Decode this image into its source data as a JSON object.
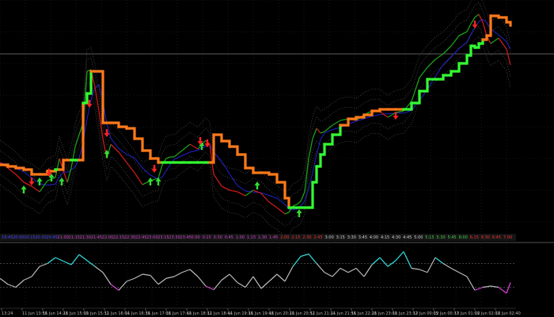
{
  "window": {
    "background": "#000000"
  },
  "chart_data": [
    {
      "type": "line",
      "panel": "price",
      "grid": true,
      "colors": {
        "trail_up": "#33ff33",
        "trail_down": "#ff7a1a",
        "price_up": "#1aa01a",
        "price_down": "#cc1a1a",
        "signal": "#2222cc",
        "band": "#666666",
        "arrow_up": "#33dd33",
        "arrow_down": "#ff2222"
      },
      "x": [
        0,
        10,
        20,
        30,
        40,
        50,
        60,
        70,
        75,
        80,
        85,
        90,
        95,
        100,
        105,
        110,
        115,
        120,
        125,
        130,
        135,
        140,
        150,
        160,
        170,
        180,
        190,
        200,
        205,
        210,
        215,
        220,
        230,
        240,
        250,
        260,
        265,
        270,
        280,
        290,
        300,
        310,
        320,
        330,
        340,
        350,
        360,
        365,
        370,
        375,
        380,
        385,
        390,
        395,
        400,
        405,
        410,
        420,
        430,
        440,
        450,
        460,
        470,
        480,
        490,
        500,
        510,
        520,
        530,
        540,
        550,
        560,
        570,
        580,
        590,
        595,
        600,
        605,
        610,
        615,
        620,
        630,
        640,
        645
      ],
      "series": [
        {
          "role": "price",
          "values": [
            205,
            212,
            220,
            230,
            235,
            242,
            228,
            224,
            200,
            215,
            230,
            212,
            185,
            170,
            155,
            90,
            88,
            110,
            140,
            175,
            200,
            182,
            192,
            205,
            218,
            233,
            228,
            225,
            208,
            200,
            198,
            198,
            190,
            182,
            188,
            177,
            182,
            220,
            235,
            240,
            242,
            247,
            240,
            244,
            255,
            262,
            270,
            268,
            260,
            258,
            254,
            242,
            200,
            175,
            162,
            168,
            166,
            158,
            152,
            150,
            152,
            145,
            140,
            141,
            148,
            142,
            140,
            128,
            98,
            85,
            75,
            68,
            58,
            45,
            40,
            30,
            22,
            18,
            28,
            45,
            55,
            48,
            62,
            82
          ]
        },
        {
          "role": "trailing_stop",
          "values": [
            208,
            210,
            212,
            214,
            220,
            220,
            216,
            214,
            214,
            202,
            202,
            202,
            202,
            202,
            130,
            118,
            90,
            90,
            90,
            155,
            155,
            155,
            160,
            162,
            175,
            190,
            200,
            205,
            205,
            205,
            205,
            205,
            205,
            205,
            205,
            205,
            205,
            170,
            178,
            185,
            195,
            212,
            218,
            218,
            220,
            230,
            250,
            262,
            262,
            262,
            262,
            262,
            262,
            230,
            210,
            195,
            182,
            170,
            158,
            150,
            148,
            145,
            140,
            138,
            138,
            138,
            138,
            130,
            115,
            100,
            100,
            95,
            90,
            80,
            70,
            58,
            60,
            55,
            50,
            45,
            20,
            22,
            28,
            32
          ]
        }
      ],
      "signals_up": [
        [
          30,
          240
        ],
        [
          50,
          230
        ],
        [
          65,
          225
        ],
        [
          78,
          230
        ],
        [
          135,
          195
        ],
        [
          190,
          230
        ],
        [
          200,
          230
        ],
        [
          255,
          185
        ],
        [
          325,
          235
        ],
        [
          378,
          270
        ]
      ],
      "signals_down": [
        [
          40,
          228
        ],
        [
          62,
          217
        ],
        [
          113,
          130
        ],
        [
          135,
          167
        ],
        [
          195,
          212
        ],
        [
          253,
          177
        ],
        [
          262,
          180
        ],
        [
          500,
          145
        ],
        [
          600,
          30
        ]
      ],
      "x_tick_labels": [
        "19:45",
        "20:00",
        "20:15",
        "20:30",
        "20:45",
        "21:00",
        "21:15",
        "21:30",
        "21:45",
        "22:00",
        "22:15",
        "22:30",
        "22:45",
        "23:00",
        "23:15",
        "23:30",
        "23:45",
        "0:00",
        "0:15",
        "0:30",
        "0:45",
        "1:00",
        "1:15",
        "1:30",
        "1:45",
        "2:00",
        "2:15",
        "2:30",
        "2:45",
        "3:00",
        "3:15",
        "3:30",
        "3:45",
        "4:00",
        "4:15",
        "4:30",
        "4:45",
        "5:00",
        "5:15",
        "5:30",
        "5:45",
        "6:00",
        "6:15",
        "6:30",
        "6:45",
        "7:00"
      ]
    },
    {
      "type": "line",
      "panel": "oscillator",
      "grid": true,
      "colors": {
        "high": "#33e0e0",
        "mid": "#bbbbbb",
        "low": "#e040e0",
        "level": "#555555"
      },
      "levels": [
        70,
        30
      ],
      "ylim": [
        0,
        100
      ],
      "x": [
        0,
        10,
        20,
        30,
        40,
        50,
        60,
        70,
        80,
        90,
        100,
        110,
        120,
        130,
        140,
        150,
        160,
        170,
        180,
        190,
        200,
        210,
        220,
        230,
        240,
        250,
        260,
        270,
        280,
        290,
        300,
        310,
        320,
        330,
        340,
        350,
        360,
        370,
        380,
        390,
        400,
        410,
        420,
        430,
        440,
        450,
        460,
        470,
        480,
        490,
        500,
        510,
        520,
        530,
        540,
        550,
        560,
        570,
        580,
        590,
        600,
        610,
        620,
        630,
        640,
        645
      ],
      "values": [
        45,
        35,
        30,
        42,
        48,
        65,
        70,
        80,
        74,
        68,
        85,
        75,
        65,
        55,
        35,
        25,
        40,
        45,
        52,
        50,
        35,
        45,
        48,
        55,
        60,
        48,
        32,
        26,
        42,
        52,
        38,
        30,
        48,
        28,
        40,
        52,
        40,
        65,
        82,
        86,
        70,
        55,
        48,
        62,
        55,
        62,
        48,
        68,
        80,
        65,
        75,
        90,
        62,
        60,
        55,
        80,
        70,
        62,
        55,
        48,
        25,
        30,
        32,
        30,
        20,
        38
      ]
    }
  ],
  "bottom_tick_labels": [
    "13:24",
    "11 Jun 13:56",
    "11 Jun 14:28",
    "11 Jun 15:00",
    "11 Jun 15:32",
    "11 Jun 16:04",
    "11 Jun 16:36",
    "11 Jun 17:08",
    "11 Jun 17:40",
    "11 Jun 18:12",
    "11 Jun 18:44",
    "11 Jun 19:16",
    "11 Jun 19:48",
    "11 Jun 20:20",
    "11 Jun 20:52",
    "11 Jun 21:24",
    "11 Jun 21:56",
    "11 Jun 22:28",
    "11 Jun 23:00",
    "11 Jun 23:32",
    "12 Jun 00:05",
    "12 Jun 00:37",
    "12 Jun 01:09",
    "12 Jun 02:09",
    "12 Jun 02:40"
  ]
}
